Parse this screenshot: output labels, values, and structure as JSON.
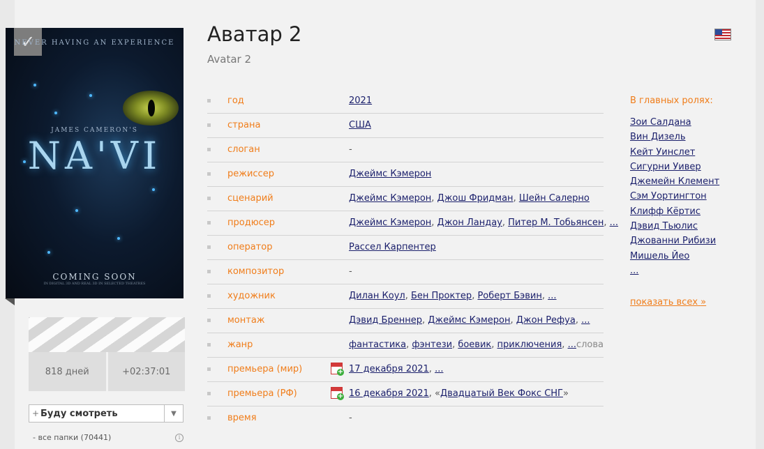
{
  "poster": {
    "tagline": "NEVER HAVING AN EXPERIENCE",
    "director_credit": "JAMES CAMERON'S",
    "logo": "NA'VI",
    "coming": "COMING SOON",
    "fine_print": "IN DIGITAL 3D AND REAL 3D IN SELECTED THEATRES"
  },
  "clapper": {
    "days": "818 дней",
    "duration": "+02:37:01"
  },
  "watch": {
    "plus": "+",
    "label": "Буду смотреть",
    "arrow": "▼"
  },
  "folders": {
    "label": "- все папки (70441)",
    "info": "i"
  },
  "movie": {
    "title": "Аватар 2",
    "original_title": "Avatar 2"
  },
  "details": {
    "year": {
      "label": "год",
      "value": "2021"
    },
    "country": {
      "label": "страна",
      "value": "США"
    },
    "slogan": {
      "label": "слоган",
      "value": "-"
    },
    "director": {
      "label": "режиссер",
      "value": "Джеймс Кэмерон"
    },
    "screenplay": {
      "label": "сценарий",
      "v1": "Джеймс Кэмерон",
      "v2": "Джош Фридман",
      "v3": "Шейн Салерно"
    },
    "producer": {
      "label": "продюсер",
      "v1": "Джеймс Кэмерон",
      "v2": "Джон Ландау",
      "v3": "Питер М. Тобьянсен",
      "more": "..."
    },
    "operator": {
      "label": "оператор",
      "value": "Рассел Карпентер"
    },
    "composer": {
      "label": "композитор",
      "value": "-"
    },
    "artist": {
      "label": "художник",
      "v1": "Дилан Коул",
      "v2": "Бен Проктер",
      "v3": "Роберт Бэвин",
      "more": "..."
    },
    "editing": {
      "label": "монтаж",
      "v1": "Дэвид Бреннер",
      "v2": "Джеймс Кэмерон",
      "v3": "Джон Рефуа",
      "more": "..."
    },
    "genre": {
      "label": "жанр",
      "v1": "фантастика",
      "v2": "фэнтези",
      "v3": "боевик",
      "v4": "приключения",
      "more": "...",
      "words": "слова"
    },
    "premiere_world": {
      "label": "премьера (мир)",
      "date": "17 декабря 2021",
      "more": "..."
    },
    "premiere_rf": {
      "label": "премьера (РФ)",
      "date": "16 декабря 2021",
      "distributor": "Двадцатый Век Фокс СНГ"
    },
    "time": {
      "label": "время",
      "value": "-"
    }
  },
  "cast": {
    "heading": "В главных ролях:",
    "actors": [
      "Зои Салдана",
      "Вин Дизель",
      "Кейт Уинслет",
      "Сигурни Уивер",
      "Джемейн Клемент",
      "Сэм Уортингтон",
      "Клифф Кёртис",
      "Дэвид Тьюлис",
      "Джованни Рибизи",
      "Мишель Йео",
      "..."
    ],
    "show_all": "показать всех",
    "show_all_arrow": "»"
  }
}
